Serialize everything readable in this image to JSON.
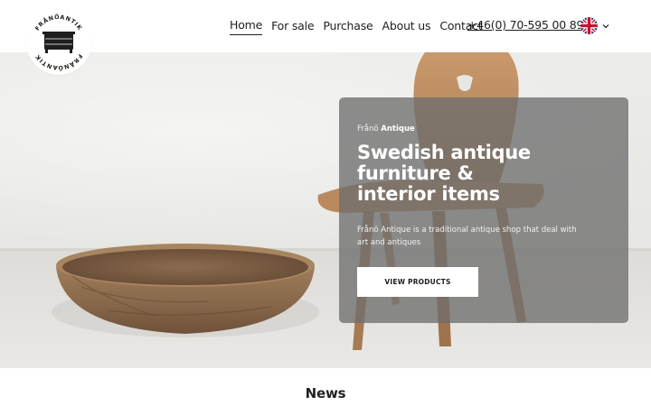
{
  "logo": {
    "text": "FRÅNÖANTIK",
    "icon": "dresser-icon"
  },
  "nav": {
    "items": [
      {
        "label": "Home",
        "active": true
      },
      {
        "label": "For sale",
        "active": false
      },
      {
        "label": "Purchase",
        "active": false
      },
      {
        "label": "About us",
        "active": false
      },
      {
        "label": "Contact",
        "active": false
      }
    ],
    "phone": "+46(0) 70-595 00 89",
    "language_flag": "uk-flag-icon",
    "language_chevron": "chevron-down-icon"
  },
  "hero": {
    "eyebrow_prefix": "Frånö",
    "eyebrow_bold": "Antique",
    "title": "Swedish antique furniture & interior items",
    "description": "Frånö Antique is a traditional antique shop that deal with art and antiques",
    "cta_label": "VIEW PRODUCTS",
    "image_subject": "wooden-bowl-and-chair-photo"
  },
  "news": {
    "title": "News"
  },
  "colors": {
    "overlay": "#6e6e6e",
    "text_dark": "#1e1e1e",
    "cta_bg": "#ffffff"
  }
}
